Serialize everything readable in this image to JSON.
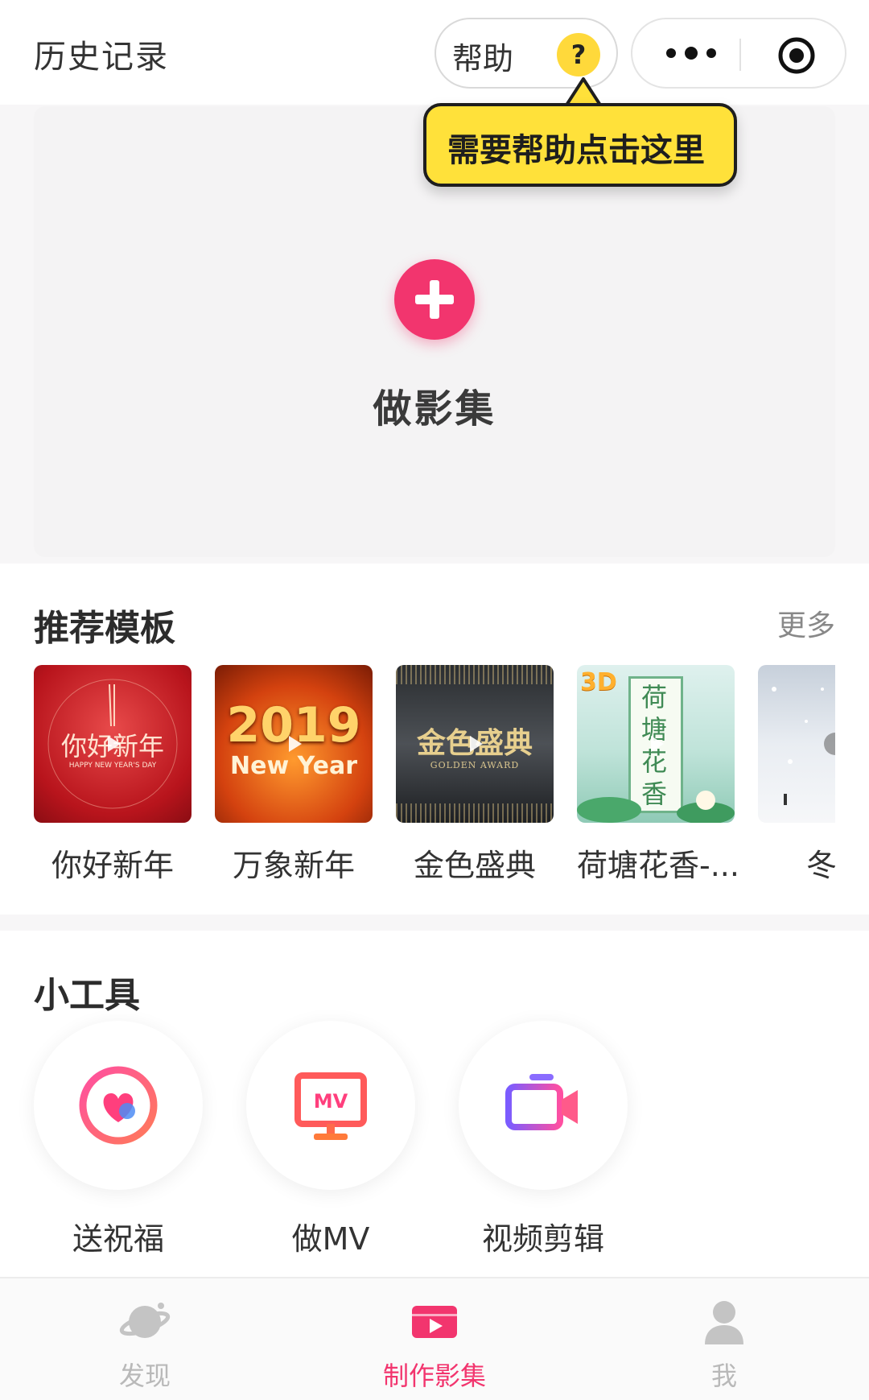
{
  "header": {
    "title": "历史记录",
    "help_label": "帮助",
    "help_icon": "?",
    "more_icon": "more-dots-icon",
    "close_icon": "target-circle-icon"
  },
  "tooltip": {
    "text": "需要帮助点击这里"
  },
  "create": {
    "label": "做影集",
    "icon": "plus-icon"
  },
  "templates": {
    "title": "推荐模板",
    "more": "更多",
    "items": [
      {
        "name": "你好新年",
        "thumb_text": "你好新年",
        "thumb_sub": "HAPPY NEW YEAR'S DAY"
      },
      {
        "name": "万象新年",
        "thumb_text": "2019",
        "thumb_sub": "New Year"
      },
      {
        "name": "金色盛典",
        "thumb_text": "金色盛典",
        "thumb_sub": "GOLDEN AWARD"
      },
      {
        "name": "荷塘花香-...",
        "thumb_text": "荷塘花香",
        "thumb_badge": "3D"
      },
      {
        "name": "冬日"
      }
    ]
  },
  "tools": {
    "title": "小工具",
    "items": [
      {
        "name": "送祝福",
        "icon": "heart-ring-icon"
      },
      {
        "name": "做MV",
        "icon": "mv-monitor-icon",
        "icon_text": "MV"
      },
      {
        "name": "视频剪辑",
        "icon": "video-camera-icon"
      }
    ]
  },
  "tabbar": {
    "items": [
      {
        "label": "发现",
        "icon": "planet-icon",
        "active": false
      },
      {
        "label": "制作影集",
        "icon": "play-screen-icon",
        "active": true
      },
      {
        "label": "我",
        "icon": "user-icon",
        "active": false
      }
    ]
  },
  "colors": {
    "accent": "#f2356e",
    "tooltip": "#ffe13a",
    "background": "#f7f6f7"
  }
}
